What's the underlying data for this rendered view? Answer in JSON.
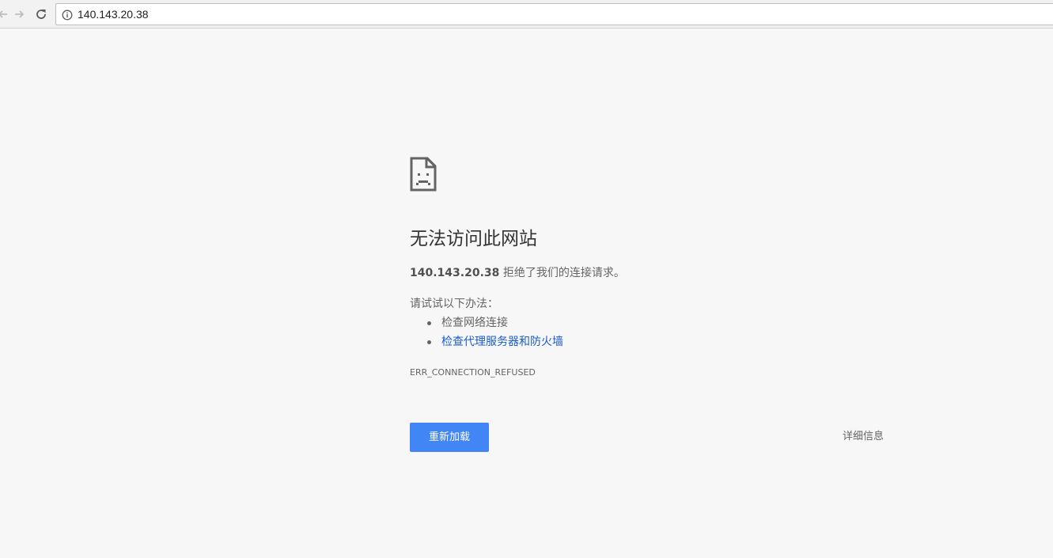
{
  "browser": {
    "url": "140.143.20.38",
    "icons": {
      "back": "back-arrow-icon",
      "forward": "forward-arrow-icon",
      "reload": "reload-icon",
      "info": "info-icon"
    }
  },
  "error_page": {
    "icon": "sad-page-icon",
    "title": "无法访问此网站",
    "host": "140.143.20.38",
    "summary_suffix": " 拒绝了我们的连接请求。",
    "suggestions_heading": "请试试以下办法：",
    "suggestions": [
      {
        "text": "检查网络连接",
        "is_link": false
      },
      {
        "text": "检查代理服务器和防火墙",
        "is_link": true
      }
    ],
    "error_code": "ERR_CONNECTION_REFUSED",
    "reload_button": "重新加载",
    "details_button": "详细信息"
  },
  "colors": {
    "accent": "#4285f4",
    "link": "#1a5cc8",
    "background": "#f7f7f7"
  }
}
